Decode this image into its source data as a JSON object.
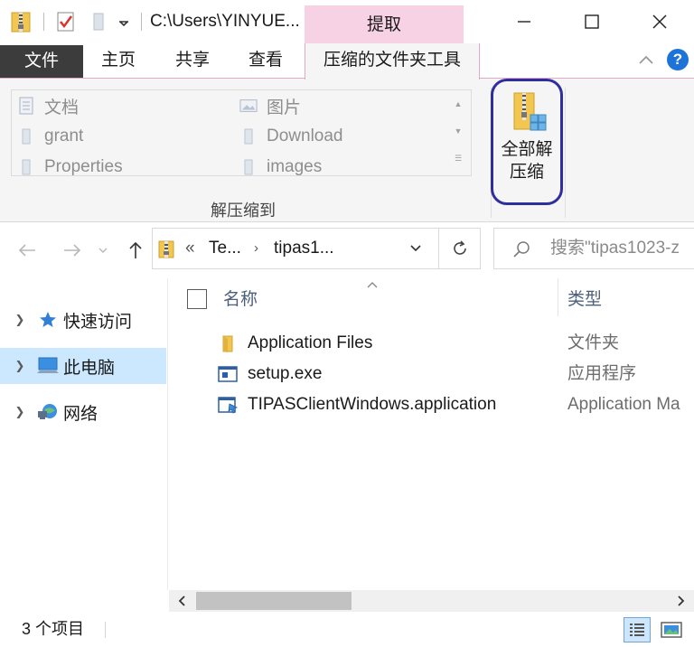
{
  "titlebar": {
    "path": "C:\\Users\\YINYUE...",
    "context_label": "提取",
    "icons": [
      "zip-folder-icon",
      "checkbox-icon",
      "folder-icon",
      "dropdown-icon"
    ]
  },
  "tabs": {
    "file": "文件",
    "home": "主页",
    "share": "共享",
    "view": "查看",
    "compressed_tools": "压缩的文件夹工具",
    "help": "?"
  },
  "ribbon": {
    "destinations": [
      {
        "label": "文档",
        "icon": "documents-icon"
      },
      {
        "label": "图片",
        "icon": "pictures-icon"
      },
      {
        "label": "grant",
        "icon": "folder-icon"
      },
      {
        "label": "Download",
        "icon": "folder-icon"
      },
      {
        "label": "Properties",
        "icon": "folder-icon"
      },
      {
        "label": "images",
        "icon": "folder-icon"
      }
    ],
    "group_label": "解压缩到",
    "extract_all_line1": "全部解",
    "extract_all_line2": "压缩"
  },
  "address": {
    "overflow": "«",
    "crumbs": [
      "Te...",
      "tipas1..."
    ],
    "search_placeholder": "搜索\"tipas1023-z"
  },
  "navpane": {
    "items": [
      {
        "label": "快速访问",
        "icon": "star-icon",
        "selected": false
      },
      {
        "label": "此电脑",
        "icon": "computer-icon",
        "selected": true
      },
      {
        "label": "网络",
        "icon": "network-icon",
        "selected": false
      }
    ]
  },
  "filelist": {
    "columns": {
      "name": "名称",
      "type": "类型"
    },
    "rows": [
      {
        "name": "Application Files",
        "type": "文件夹",
        "icon": "folder-icon"
      },
      {
        "name": "setup.exe",
        "type": "应用程序",
        "icon": "exe-icon"
      },
      {
        "name": "TIPASClientWindows.application",
        "type": "Application Ma",
        "icon": "application-manifest-icon"
      }
    ]
  },
  "statusbar": {
    "count": "3 个项目"
  },
  "colors": {
    "accent_pink": "#f7d1e4",
    "file_tab": "#3c3c3c",
    "selection": "#cce8ff",
    "highlight_ring": "#2e2e9e",
    "help_blue": "#1d73d8"
  }
}
